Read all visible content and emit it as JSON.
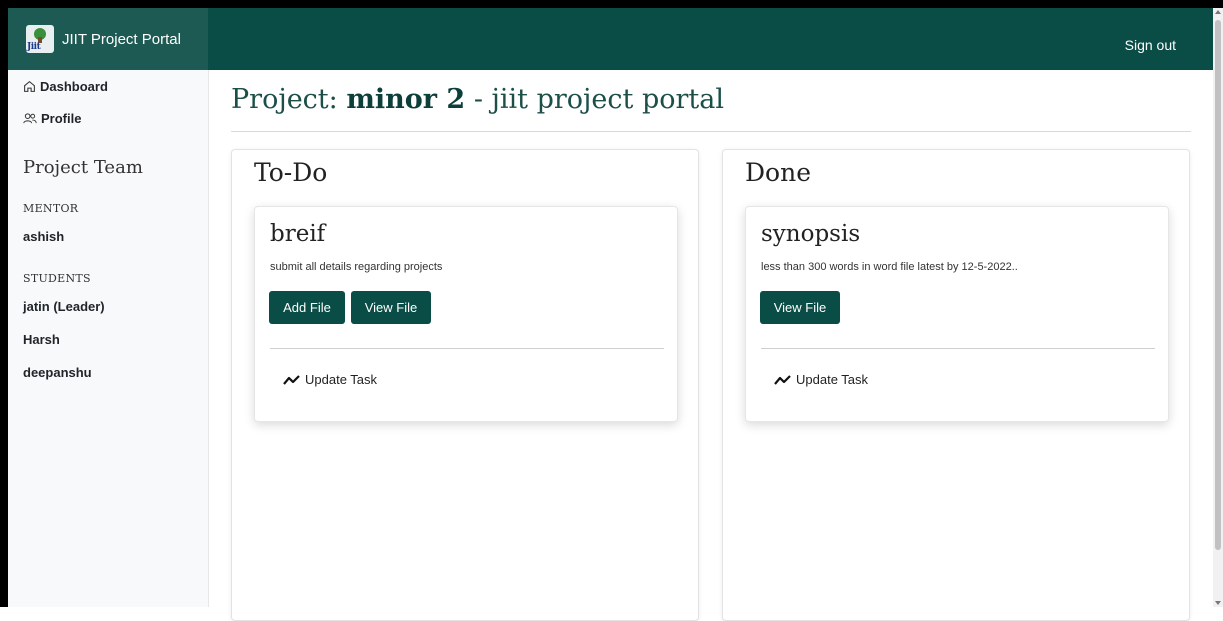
{
  "app": {
    "title": "JIIT Project Portal",
    "logo_text": "Jiit",
    "signout_label": "Sign out"
  },
  "sidebar": {
    "nav": [
      {
        "label": "Dashboard",
        "icon": "home-icon"
      },
      {
        "label": "Profile",
        "icon": "people-icon"
      }
    ],
    "team_heading": "Project Team",
    "mentor_caption": "MENTOR",
    "mentor": "ashish",
    "students_caption": "STUDENTS",
    "students": [
      "jatin (Leader)",
      "Harsh",
      "deepanshu"
    ]
  },
  "page": {
    "title_prefix": "Project: ",
    "project_name": "minor 2",
    "title_suffix": " - jiit project portal"
  },
  "columns": [
    {
      "title": "To-Do",
      "task": {
        "title": "breif",
        "description": "submit all details regarding projects",
        "buttons": [
          "Add File",
          "View File"
        ],
        "update_label": "Update Task"
      }
    },
    {
      "title": "Done",
      "task": {
        "title": "synopsis",
        "description": "less than 300 words in word file latest by 12-5-2022..",
        "buttons": [
          "View File"
        ],
        "update_label": "Update Task"
      }
    }
  ],
  "colors": {
    "primary": "#0a4d46",
    "brand_panel": "#1d5a53",
    "sidebar_bg": "#f8f9fa"
  }
}
